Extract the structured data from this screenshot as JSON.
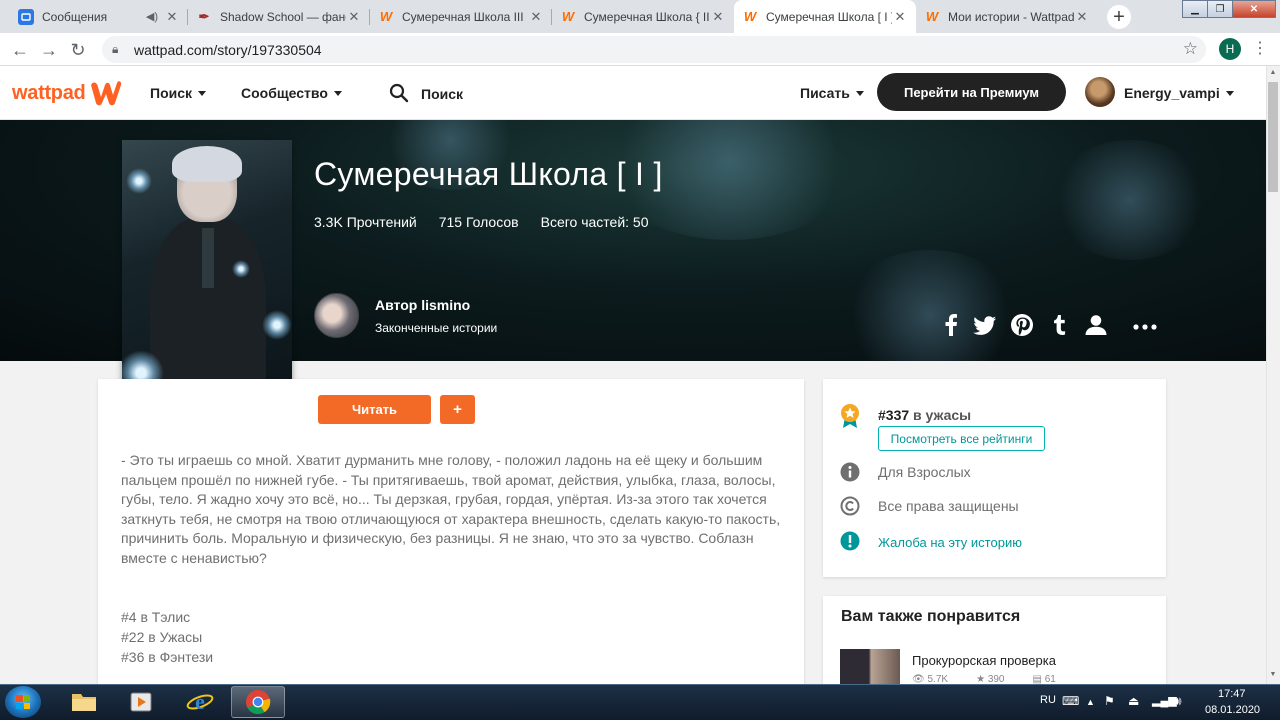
{
  "browser": {
    "tabs": [
      {
        "title": "Сообщения",
        "favicon": "messages-icon",
        "active": false,
        "muted": true
      },
      {
        "title": "Shadow School — фанфик",
        "favicon": "ficbook-icon",
        "active": false
      },
      {
        "title": "Сумеречная Школа III ·",
        "favicon": "wattpad-icon",
        "active": false
      },
      {
        "title": "Сумеречная Школа { II",
        "favicon": "wattpad-icon",
        "active": false
      },
      {
        "title": "Сумеречная Школа [ I ]",
        "favicon": "wattpad-icon",
        "active": true
      },
      {
        "title": "Мои истории - Wattpad",
        "favicon": "wattpad-icon",
        "active": false
      }
    ],
    "url": "wattpad.com/story/197330504",
    "profile_initial": "H"
  },
  "header": {
    "logo": "wattpad",
    "nav_search": "Поиск",
    "nav_community": "Сообщество",
    "search_label": "Поиск",
    "write": "Писать",
    "premium": "Перейти на Премиум",
    "username": "Energy_vampi"
  },
  "story": {
    "title": "Сумеречная Школа [ I ]",
    "reads": "3.3K Прочтений",
    "votes": "715 Голосов",
    "parts": "Всего частей: 50",
    "author": "Автор lismino",
    "status": "Законченные истории",
    "read_button": "Читать",
    "add_button": "+",
    "description": "- Это ты играешь со мной. Хватит дурманить мне голову, - положил ладонь на её щеку и большим пальцем прошёл по нижней губе. - Ты притягиваешь, твой аромат, действия, улыбка, глаза, волосы, губы, тело. Я жадно хочу это всё, но... Ты дерзкая, грубая, гордая, упёртая. Из-за этого так хочется заткнуть тебя, не смотря на твою отличающуюся от характера внешность, сделать какую-то пакость, причинить боль. Моральную и физическую, без разницы. Я не знаю, что это за чувство. Соблазн вместе с ненавистью?",
    "tags": [
      "#4 в Тэлис",
      "#22 в Ужасы",
      "#36 в Фэнтези"
    ]
  },
  "sidebar": {
    "rank_num": "#337",
    "rank_cat": " в ужасы",
    "ratings_button": "Посмотреть все рейтинги",
    "mature": "Для Взрослых",
    "copyright": "Все права защищены",
    "report": "Жалоба на эту историю"
  },
  "recommend": {
    "heading": "Вам также понравится",
    "item_title": "Прокурорская проверка",
    "item_reads": "5.7K",
    "item_votes": "390",
    "item_parts": "61"
  },
  "taskbar": {
    "lang": "RU",
    "time": "17:47",
    "date": "08.01.2020"
  },
  "colors": {
    "wattpad_orange": "#ff6122",
    "read_button": "#f26a25",
    "teal_link": "#00979a"
  }
}
